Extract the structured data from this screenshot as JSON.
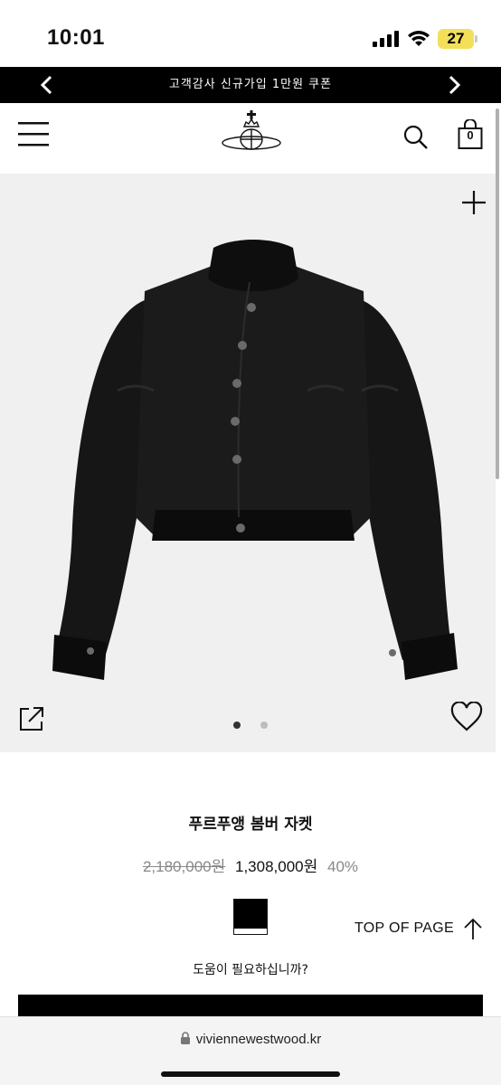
{
  "status_bar": {
    "time": "10:01",
    "battery": "27"
  },
  "promo": {
    "text": "고객감사 신규가입 1만원 쿠폰"
  },
  "header": {
    "bag_count": "0"
  },
  "product": {
    "name": "푸르푸앵 봄버 자켓",
    "price_original": "2,180,000원",
    "price_sale": "1,308,000원",
    "discount": "40%",
    "image_count": 2,
    "active_image": 1,
    "color_swatches": [
      {
        "color": "#000000",
        "selected": true
      }
    ]
  },
  "actions": {
    "top_of_page": "TOP OF PAGE",
    "help": "도움이 필요하십니까?"
  },
  "browser": {
    "url": "viviennewestwood.kr"
  },
  "colors": {
    "accent": "#000000",
    "banner_bg": "#000000",
    "image_bg": "#f0f0f0",
    "muted": "#888888",
    "battery": "#f3df5a"
  }
}
